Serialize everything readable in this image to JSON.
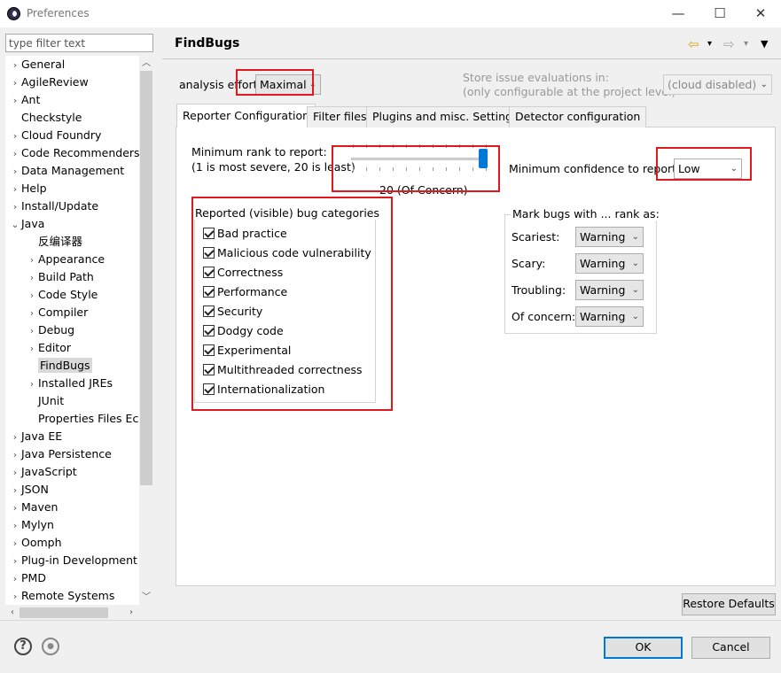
{
  "window": {
    "title": "Preferences",
    "minimize": "—",
    "maximize": "☐",
    "close": "✕"
  },
  "filter": {
    "placeholder": "type filter text"
  },
  "tree": [
    {
      "label": "General",
      "arrow": "›",
      "level": 0
    },
    {
      "label": "AgileReview",
      "arrow": "›",
      "level": 0
    },
    {
      "label": "Ant",
      "arrow": "›",
      "level": 0
    },
    {
      "label": "Checkstyle",
      "arrow": "",
      "level": 0
    },
    {
      "label": "Cloud Foundry",
      "arrow": "›",
      "level": 0
    },
    {
      "label": "Code Recommenders",
      "arrow": "›",
      "level": 0
    },
    {
      "label": "Data Management",
      "arrow": "›",
      "level": 0
    },
    {
      "label": "Help",
      "arrow": "›",
      "level": 0
    },
    {
      "label": "Install/Update",
      "arrow": "›",
      "level": 0
    },
    {
      "label": "Java",
      "arrow": "⌄",
      "level": 0
    },
    {
      "label": "反编译器",
      "arrow": "",
      "level": 1
    },
    {
      "label": "Appearance",
      "arrow": "›",
      "level": 1
    },
    {
      "label": "Build Path",
      "arrow": "›",
      "level": 1
    },
    {
      "label": "Code Style",
      "arrow": "›",
      "level": 1
    },
    {
      "label": "Compiler",
      "arrow": "›",
      "level": 1
    },
    {
      "label": "Debug",
      "arrow": "›",
      "level": 1
    },
    {
      "label": "Editor",
      "arrow": "›",
      "level": 1
    },
    {
      "label": "FindBugs",
      "arrow": "",
      "level": 1,
      "selected": true
    },
    {
      "label": "Installed JREs",
      "arrow": "›",
      "level": 1
    },
    {
      "label": "JUnit",
      "arrow": "",
      "level": 1
    },
    {
      "label": "Properties Files Ec",
      "arrow": "",
      "level": 1
    },
    {
      "label": "Java EE",
      "arrow": "›",
      "level": 0
    },
    {
      "label": "Java Persistence",
      "arrow": "›",
      "level": 0
    },
    {
      "label": "JavaScript",
      "arrow": "›",
      "level": 0
    },
    {
      "label": "JSON",
      "arrow": "›",
      "level": 0
    },
    {
      "label": "Maven",
      "arrow": "›",
      "level": 0
    },
    {
      "label": "Mylyn",
      "arrow": "›",
      "level": 0
    },
    {
      "label": "Oomph",
      "arrow": "›",
      "level": 0
    },
    {
      "label": "Plug-in Development",
      "arrow": "›",
      "level": 0
    },
    {
      "label": "PMD",
      "arrow": "›",
      "level": 0
    },
    {
      "label": "Remote Systems",
      "arrow": "›",
      "level": 0
    }
  ],
  "page": {
    "title": "FindBugs",
    "nav": {
      "back": "⇦",
      "forward": "⇨",
      "dropdown": "▾",
      "menu": "▼"
    },
    "analysis_effort_label": "analysis effort",
    "analysis_effort_value": "Maximal",
    "store_label_1": "Store issue evaluations in:",
    "store_label_2": "(only configurable at the project level)",
    "store_value": "(cloud disabled)"
  },
  "tabs": [
    "Reporter Configuration",
    "Filter files",
    "Plugins and misc. Settings",
    "Detector configuration"
  ],
  "reporter": {
    "min_rank_label_1": "Minimum rank to report:",
    "min_rank_label_2": "(1 is most severe, 20 is least)",
    "rank_value": 20,
    "rank_max": 20,
    "rank_caption": "20 (Of Concern)",
    "min_confidence_label": "Minimum confidence to report:",
    "min_confidence_value": "Low",
    "categories_title": "Reported (visible) bug categories",
    "categories": [
      {
        "label": "Bad practice",
        "checked": true
      },
      {
        "label": "Malicious code vulnerability",
        "checked": true
      },
      {
        "label": "Correctness",
        "checked": true
      },
      {
        "label": "Performance",
        "checked": true
      },
      {
        "label": "Security",
        "checked": true
      },
      {
        "label": "Dodgy code",
        "checked": true
      },
      {
        "label": "Experimental",
        "checked": true
      },
      {
        "label": "Multithreaded correctness",
        "checked": true
      },
      {
        "label": "Internationalization",
        "checked": true
      }
    ],
    "mark_title": "Mark bugs with ... rank as:",
    "mark_rows": [
      {
        "label": "Scariest:",
        "value": "Warning"
      },
      {
        "label": "Scary:",
        "value": "Warning"
      },
      {
        "label": "Troubling:",
        "value": "Warning"
      },
      {
        "label": "Of concern:",
        "value": "Warning"
      }
    ]
  },
  "buttons": {
    "restore_defaults": "Restore Defaults",
    "ok": "OK",
    "cancel": "Cancel"
  },
  "footer": {
    "help": "?",
    "import_export": "●"
  },
  "colors": {
    "highlight": "#e0191f",
    "slider_thumb": "#0078d7"
  }
}
